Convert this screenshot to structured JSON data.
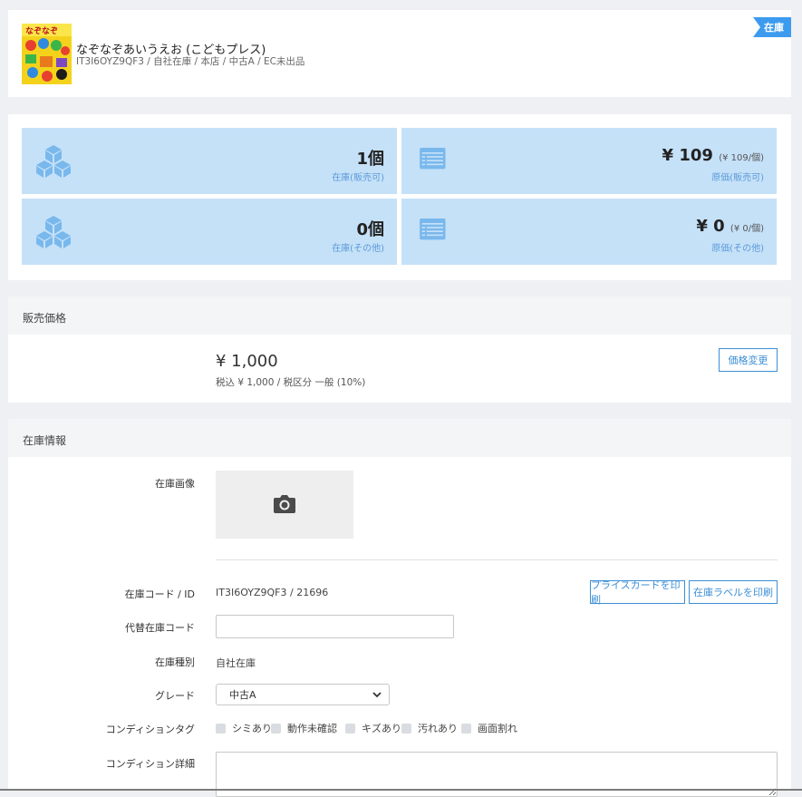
{
  "header": {
    "title": "なぞなぞあいうえお (こどもプレス)",
    "subline": "IT3I6OYZ9QF3 / 自社在庫 / 本店 / 中古A / EC未出品",
    "status_badge": "在庫",
    "cover_text": "なぞなぞ"
  },
  "stats": {
    "stock_sellable_value": "1個",
    "stock_sellable_label": "在庫(販売可)",
    "cost_sellable_value": "¥ 109",
    "cost_sellable_unit": "(¥ 109/個)",
    "cost_sellable_label": "原価(販売可)",
    "stock_other_value": "0個",
    "stock_other_label": "在庫(その他)",
    "cost_other_value": "¥ 0",
    "cost_other_unit": "(¥ 0/個)",
    "cost_other_label": "原価(その他)"
  },
  "price": {
    "heading": "販売価格",
    "amount": "¥ 1,000",
    "tax_detail": "税込 ¥ 1,000 / 税区分 一般 (10%)",
    "change_button": "価格変更"
  },
  "stock_info": {
    "heading": "在庫情報",
    "image_label": "在庫画像",
    "code_label": "在庫コード / ID",
    "code_value": "IT3I6OYZ9QF3 / 21696",
    "print_price_card": "プライスカードを印刷",
    "print_stock_label": "在庫ラベルを印刷",
    "alt_code_label": "代替在庫コード",
    "alt_code_value": "",
    "type_label": "在庫種別",
    "type_value": "自社在庫",
    "grade_label": "グレード",
    "grade_value": "中古A",
    "condition_tags_label": "コンディションタグ",
    "condition_tags": [
      "シミあり",
      "動作未確認",
      "キズあり",
      "汚れあり",
      "画面割れ"
    ],
    "condition_detail_label": "コンディション詳細",
    "condition_detail_value": ""
  },
  "colors": {
    "accent": "#3d9bef",
    "tile_bg": "#c5e1f8",
    "tile_icon": "#79b8ec"
  },
  "icons": [
    "cubes-icon",
    "list-card-icon",
    "camera-icon",
    "chevron-down-icon"
  ]
}
